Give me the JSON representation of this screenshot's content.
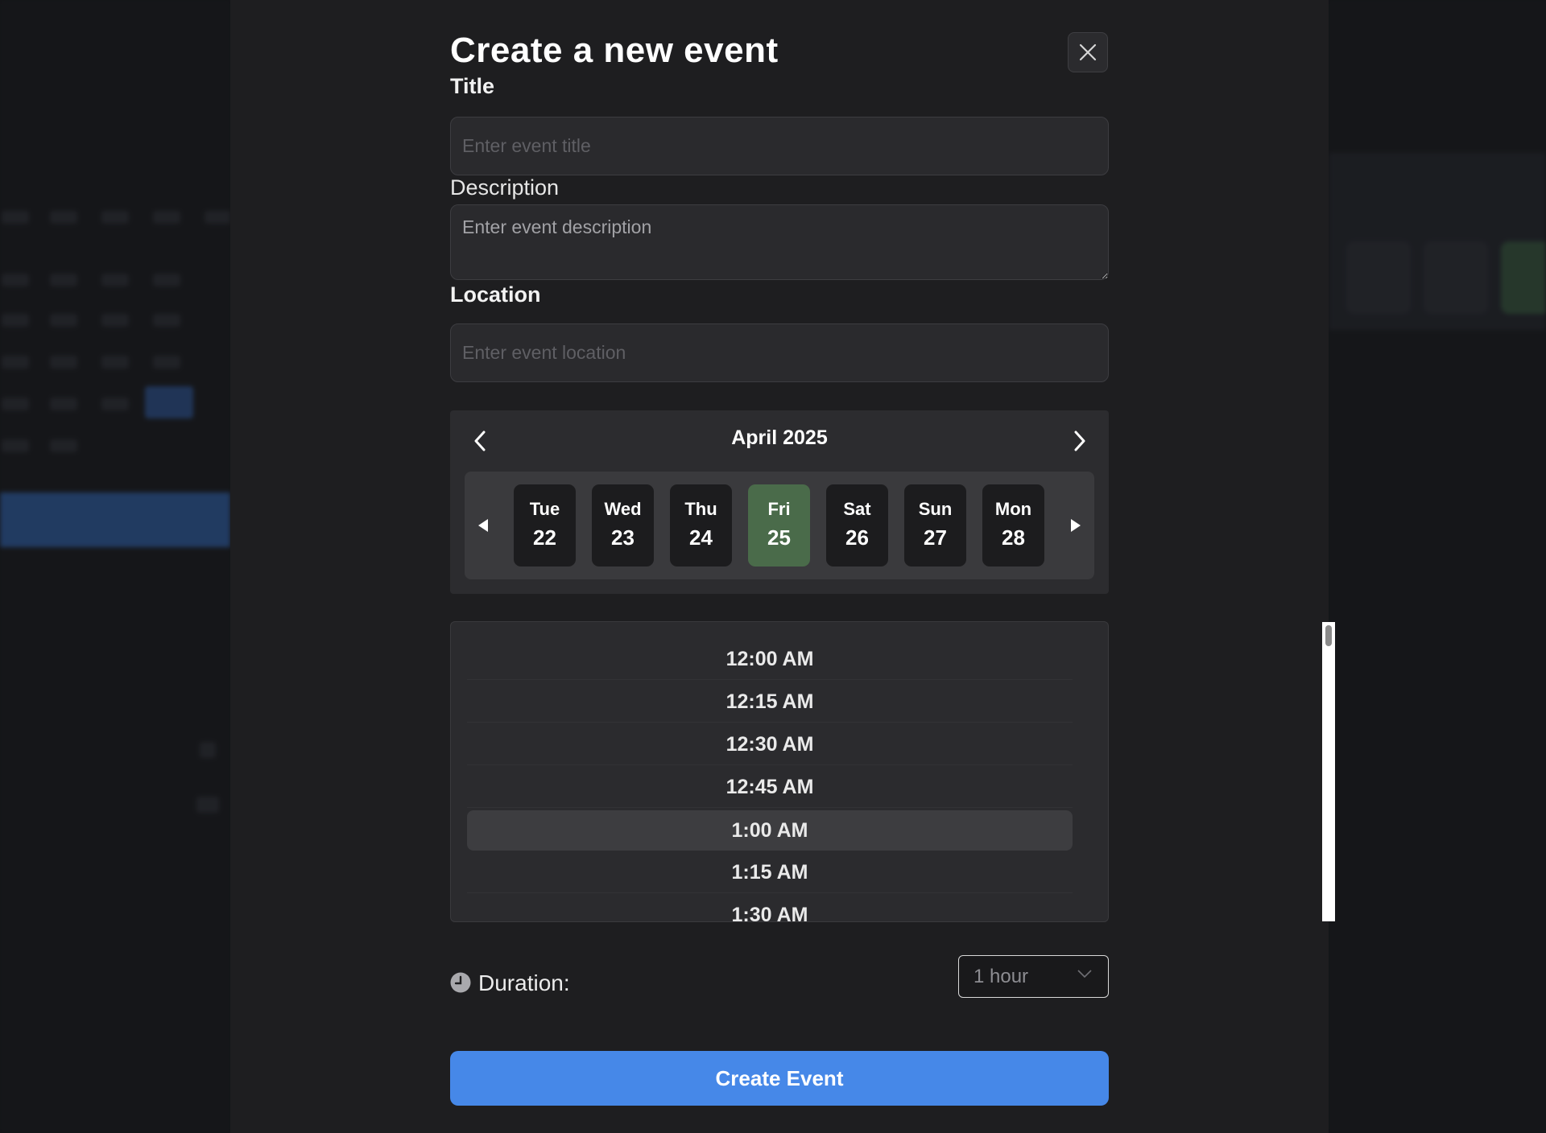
{
  "modal": {
    "title": "Create a new event",
    "close_icon": "close-icon"
  },
  "form": {
    "title_label": "Title",
    "title_placeholder": "Enter event title",
    "description_label": "Description",
    "description_placeholder": "Enter event description",
    "location_label": "Location",
    "location_placeholder": "Enter event location"
  },
  "datepicker": {
    "month": "April 2025",
    "prev_icon": "chevron-left-icon",
    "next_icon": "chevron-right-icon",
    "strip_prev_icon": "triangle-left-icon",
    "strip_next_icon": "triangle-right-icon",
    "days": [
      {
        "name": "Tue",
        "num": "22",
        "selected": false
      },
      {
        "name": "Wed",
        "num": "23",
        "selected": false
      },
      {
        "name": "Thu",
        "num": "24",
        "selected": false
      },
      {
        "name": "Fri",
        "num": "25",
        "selected": true
      },
      {
        "name": "Sat",
        "num": "26",
        "selected": false
      },
      {
        "name": "Sun",
        "num": "27",
        "selected": false
      },
      {
        "name": "Mon",
        "num": "28",
        "selected": false
      }
    ]
  },
  "times": [
    {
      "label": "12:00 AM",
      "selected": false
    },
    {
      "label": "12:15 AM",
      "selected": false
    },
    {
      "label": "12:30 AM",
      "selected": false
    },
    {
      "label": "12:45 AM",
      "selected": false
    },
    {
      "label": "1:00 AM",
      "selected": true
    },
    {
      "label": "1:15 AM",
      "selected": false
    },
    {
      "label": "1:30 AM",
      "selected": false
    }
  ],
  "duration": {
    "icon": "clock-icon",
    "label": "Duration:",
    "value": "1 hour"
  },
  "actions": {
    "create_label": "Create Event"
  },
  "colors": {
    "accent": "#4688e8",
    "selected_day": "#4a6b4a",
    "modal_bg": "#1e1e20"
  }
}
